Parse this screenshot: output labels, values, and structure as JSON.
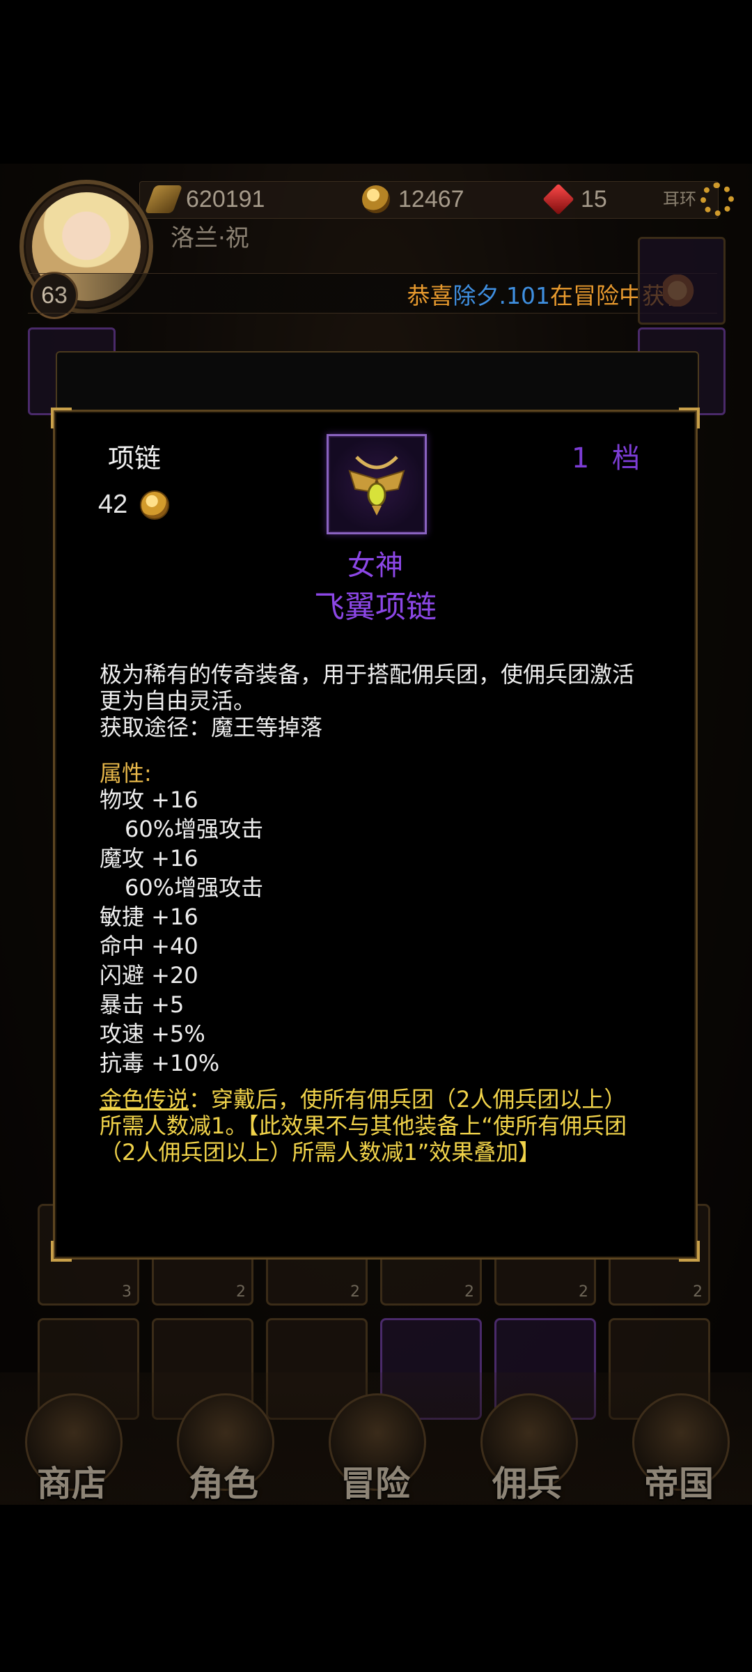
{
  "header": {
    "player_name": "洛兰·祝",
    "level": "63",
    "exp": "620191",
    "gold": "12467",
    "gems": "15",
    "slot_label": "耳环",
    "notice": {
      "prefix": "恭喜",
      "player": "除夕.101",
      "suffix": "在冒险中获得"
    }
  },
  "grid_counts": [
    "3",
    "2",
    "2",
    "2",
    "2",
    "2"
  ],
  "nav": [
    "商店",
    "角色",
    "冒险",
    "佣兵",
    "帝国"
  ],
  "item": {
    "type": "项链",
    "price": "42",
    "tier": "1 档",
    "name_line1": "女神",
    "name_line2": "飞翼项链",
    "desc_line1": "极为稀有的传奇装备，用于搭配佣兵团，使佣兵团激活",
    "desc_line2": "更为自由灵活。",
    "desc_line3": "获取途径：魔王等掉落",
    "attr_title": "属性:",
    "attrs": [
      "物攻 +16",
      "60%增强攻击",
      "魔攻 +16",
      "60%增强攻击",
      "敏捷 +16",
      "命中 +40",
      "闪避 +20",
      "暴击 +5",
      "攻速 +5%",
      "抗毒 +10%"
    ],
    "legend_label": "金色传说",
    "legend_line1": "：穿戴后，使所有佣兵团（2人佣兵团以上）",
    "legend_line2": "所需人数减1。【此效果不与其他装备上“使所有佣兵团",
    "legend_line3": "（2人佣兵团以上）所需人数减1”效果叠加】"
  },
  "colors": {
    "accent_purple": "#8c47e6",
    "legend_gold": "#f1d34a",
    "attr_title": "#e8b84a",
    "frame_gold": "#c8a04a"
  }
}
